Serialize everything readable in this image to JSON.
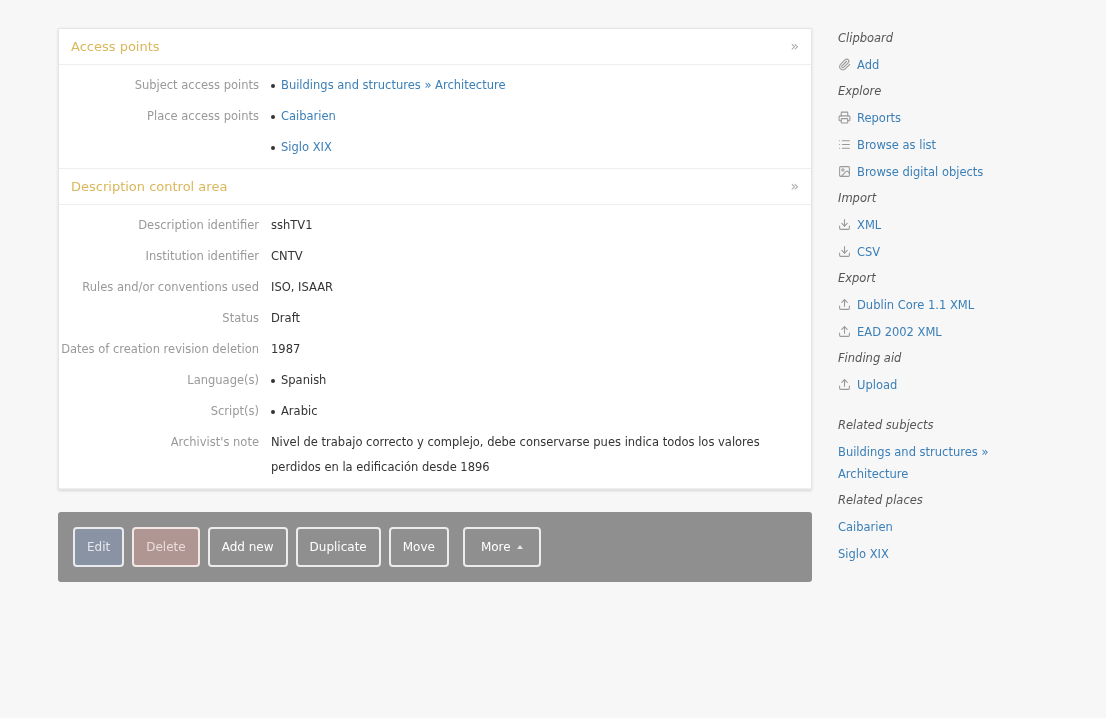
{
  "sections": [
    {
      "title": "Access points",
      "toggle": "»",
      "fields": [
        {
          "label": "Subject access points",
          "kind": "links",
          "items": [
            "Buildings and structures » Architecture"
          ]
        },
        {
          "label": "Place access points",
          "kind": "links",
          "items": [
            "Caibarien",
            "Siglo XIX"
          ]
        }
      ]
    },
    {
      "title": "Description control area",
      "toggle": "»",
      "fields": [
        {
          "label": "Description identifier",
          "kind": "text",
          "value": "sshTV1"
        },
        {
          "label": "Institution identifier",
          "kind": "text",
          "value": "CNTV"
        },
        {
          "label": "Rules and/or conventions used",
          "kind": "text",
          "value": "ISO, ISAAR"
        },
        {
          "label": "Status",
          "kind": "text",
          "value": "Draft"
        },
        {
          "label": "Dates of creation revision deletion",
          "kind": "text",
          "value": "1987"
        },
        {
          "label": "Language(s)",
          "kind": "list",
          "items": [
            "Spanish"
          ]
        },
        {
          "label": "Script(s)",
          "kind": "list",
          "items": [
            "Arabic"
          ]
        },
        {
          "label": "Archivist's note",
          "kind": "text",
          "value": "Nivel de trabajo correcto y complejo, debe conservarse pues indica todos los valores perdidos en la edificación desde 1896"
        }
      ]
    }
  ],
  "actions": [
    {
      "label": "Edit",
      "kind": "primary"
    },
    {
      "label": "Delete",
      "kind": "danger"
    },
    {
      "label": "Add new",
      "kind": "plain"
    },
    {
      "label": "Duplicate",
      "kind": "plain"
    },
    {
      "label": "Move",
      "kind": "plain"
    },
    {
      "label": "More",
      "kind": "dropdown"
    }
  ],
  "sidebar": [
    {
      "heading": "Clipboard",
      "links": [
        {
          "label": "Add",
          "kind": "paperclip"
        }
      ]
    },
    {
      "heading": "Explore",
      "links": [
        {
          "label": "Reports",
          "kind": "print"
        },
        {
          "label": "Browse as list",
          "kind": "list"
        },
        {
          "label": "Browse digital objects",
          "kind": "image"
        }
      ]
    },
    {
      "heading": "Import",
      "links": [
        {
          "label": "XML",
          "kind": "download"
        },
        {
          "label": "CSV",
          "kind": "download"
        }
      ]
    },
    {
      "heading": "Export",
      "links": [
        {
          "label": "Dublin Core 1.1 XML",
          "kind": "upload"
        },
        {
          "label": "EAD 2002 XML",
          "kind": "upload"
        }
      ]
    },
    {
      "heading": "Finding aid",
      "links": [
        {
          "label": "Upload",
          "kind": "upload"
        }
      ]
    },
    {
      "heading": "Related subjects",
      "links": [
        {
          "label": "Buildings and structures » Architecture",
          "kind": "plain"
        }
      ]
    },
    {
      "heading": "Related places",
      "links": [
        {
          "label": "Caibarien",
          "kind": "plain"
        },
        {
          "label": "Siglo XIX",
          "kind": "plain"
        }
      ]
    }
  ]
}
